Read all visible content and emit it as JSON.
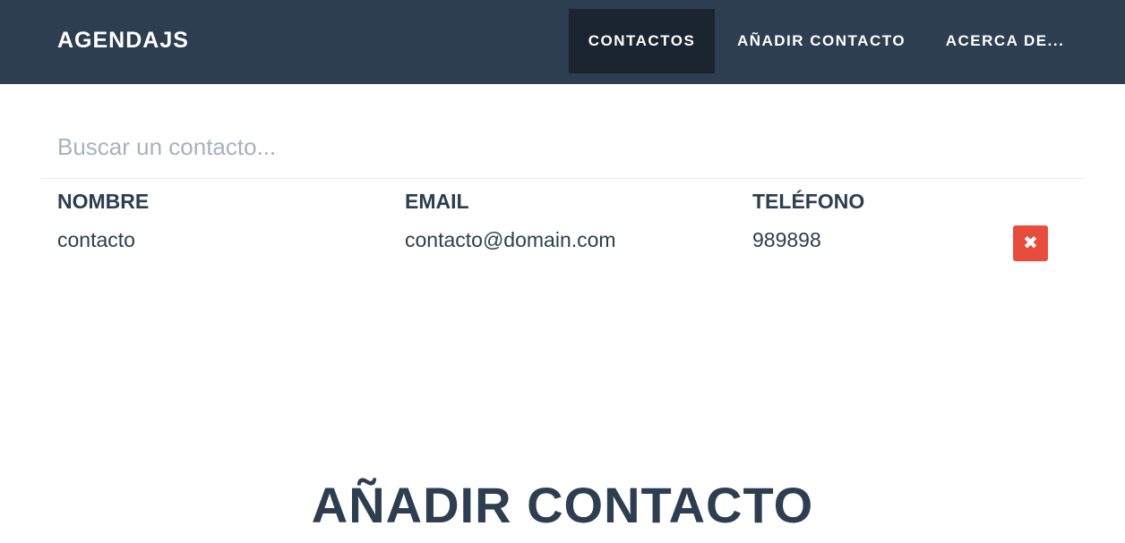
{
  "navbar": {
    "brand": "AGENDAJS",
    "items": [
      {
        "label": "CONTACTOS",
        "active": true
      },
      {
        "label": "AÑADIR CONTACTO",
        "active": false
      },
      {
        "label": "ACERCA DE...",
        "active": false
      }
    ],
    "background_color": "#2c3e50",
    "active_background_color": "#1a252f"
  },
  "search": {
    "placeholder": "Buscar un contacto...",
    "value": ""
  },
  "table": {
    "headers": [
      "NOMBRE",
      "EMAIL",
      "TELÉFONO"
    ],
    "rows": [
      {
        "nombre": "contacto",
        "email": "contacto@domain.com",
        "telefono": "989898",
        "delete_icon": "close-icon",
        "delete_symbol": "✖"
      }
    ],
    "delete_color": "#e74c3c"
  },
  "add_section": {
    "title": "AÑADIR CONTACTO"
  }
}
